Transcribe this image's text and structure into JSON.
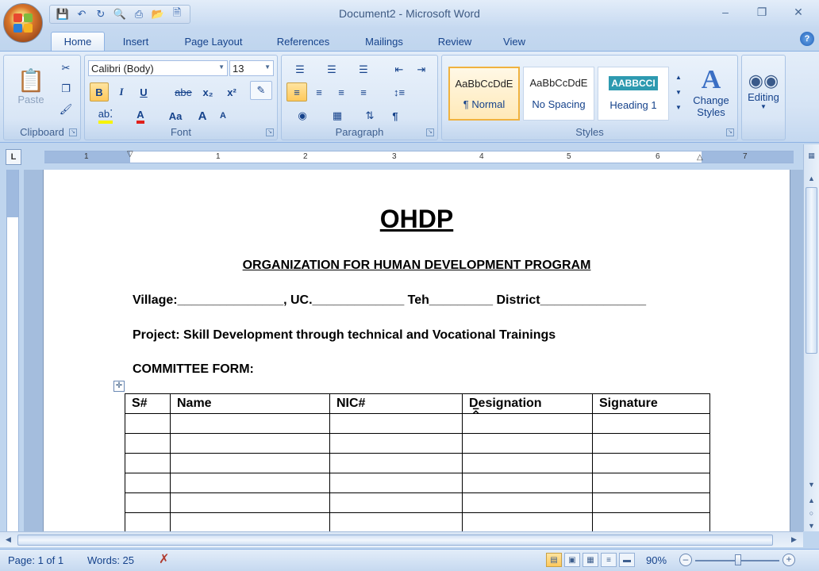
{
  "window": {
    "title": "Document2 - Microsoft Word"
  },
  "qat": {
    "icons": [
      "save-icon",
      "undo-icon",
      "redo-icon",
      "print-preview-icon",
      "print-icon",
      "open-icon",
      "new-document-icon"
    ]
  },
  "tabs": [
    {
      "label": "Home",
      "active": true
    },
    {
      "label": "Insert"
    },
    {
      "label": "Page Layout"
    },
    {
      "label": "References"
    },
    {
      "label": "Mailings"
    },
    {
      "label": "Review"
    },
    {
      "label": "View"
    }
  ],
  "ribbon": {
    "clipboard": {
      "label": "Clipboard",
      "paste_label": "Paste"
    },
    "font": {
      "label": "Font",
      "font_name": "Calibri (Body)",
      "font_size": "13",
      "bold": "B",
      "italic": "I",
      "underline": "U",
      "strike": "abe",
      "subscript": "x₂",
      "superscript": "x²",
      "change_case": "Aa",
      "grow": "A",
      "shrink": "A"
    },
    "paragraph": {
      "label": "Paragraph",
      "show_marks": "¶"
    },
    "styles": {
      "label": "Styles",
      "items": [
        {
          "sample": "AaBbCcDdE",
          "name": "¶ Normal",
          "active": true
        },
        {
          "sample": "AaBbCcDdE",
          "name": "No Spacing"
        },
        {
          "sample": "AABBCCI",
          "name": "Heading 1"
        }
      ],
      "change_styles_line1": "Change",
      "change_styles_line2": "Styles"
    },
    "editing": {
      "label": "Editing"
    }
  },
  "ruler": {
    "numbers": [
      "1",
      "1",
      "2",
      "3",
      "4",
      "5",
      "6",
      "7"
    ]
  },
  "document": {
    "title": "OHDP",
    "org": "ORGANIZATION FOR HUMAN DEVELOPMENT PROGRAM",
    "village_line": "Village:_______________, UC._____________ Teh_________ District_______________",
    "project_line": "Project: Skill Development through technical and Vocational Trainings",
    "committee_line": "COMMITTEE FORM:",
    "table": {
      "headers": [
        "S#",
        "Name",
        "NIC#",
        "Designation",
        "Signature"
      ],
      "empty_rows": 6
    }
  },
  "status": {
    "page": "Page: 1 of 1",
    "words": "Words: 25",
    "zoom": "90%",
    "zoom_level_percent": 90
  },
  "colors": {
    "ribbon_bg": "#d6e4f5",
    "accent": "#15428b",
    "highlight": "#ffc95c"
  }
}
